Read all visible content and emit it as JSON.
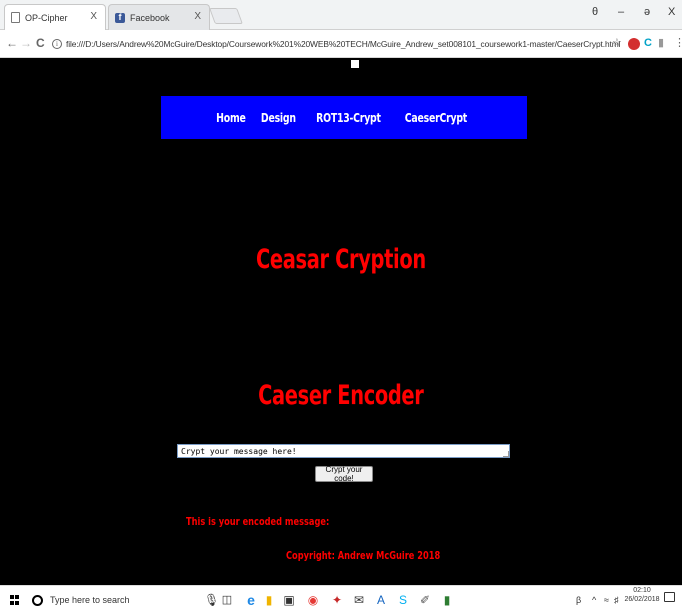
{
  "browser": {
    "tabs": [
      {
        "title": "OP-Cipher",
        "close": "X",
        "active": true
      },
      {
        "title": "Facebook",
        "close": "X",
        "active": false
      }
    ],
    "window_controls": {
      "profile": "θ",
      "minimize": "–",
      "restore": "ə",
      "close": "X"
    },
    "nav": {
      "back": "←",
      "forward": "→",
      "reload": "C"
    },
    "address": {
      "info": "i",
      "url": "file:///D:/Users/Andrew%20McGuire/Desktop/Coursework%201%20WEB%20TECH/McGuire_Andrew_set008101_coursework1-master/CaeserCrypt.html"
    },
    "extensions": {
      "star": "☆",
      "menu": "⋮"
    }
  },
  "page": {
    "navbar": {
      "items": [
        "Home",
        "Design",
        "ROT13-Crypt",
        "CaeserCrypt"
      ],
      "bg": "#0000ff"
    },
    "title1": "Ceasar Cryption",
    "title2": "Caeser Encoder",
    "textarea_value": "Crypt your message here!",
    "button_label": "Crypt your code!",
    "encoded_label": "This is your encoded message:",
    "copyright": "Copyright: Andrew McGuire 2018",
    "accent": "#ff0000"
  },
  "taskbar": {
    "search_placeholder": "Type here to search",
    "clock_time": "02:10",
    "clock_date": "26/02/2018"
  }
}
